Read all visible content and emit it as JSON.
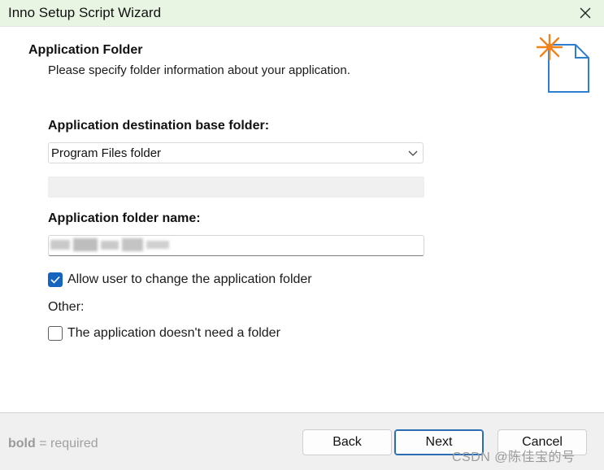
{
  "window": {
    "title": "Inno Setup Script Wizard"
  },
  "header": {
    "title": "Application Folder",
    "subtitle": "Please specify folder information about your application."
  },
  "form": {
    "base_folder_label": "Application destination base folder:",
    "base_folder_selected": "Program Files folder",
    "custom_folder_value": "",
    "folder_name_label": "Application folder name:",
    "folder_name_value": "",
    "allow_change_label": "Allow user to change the application folder",
    "allow_change_checked": true,
    "other_label": "Other:",
    "no_folder_label": "The application doesn't need a folder",
    "no_folder_checked": false
  },
  "footer": {
    "legend_bold": "bold",
    "legend_rest": " = required",
    "back_label": "Back",
    "next_label": "Next",
    "cancel_label": "Cancel",
    "watermark": "CSDN @陈佳宝的号"
  },
  "colors": {
    "titlebar_bg": "#e9f5e3",
    "checkbox_accent": "#1565c0",
    "icon_blue": "#2f7fd0",
    "icon_orange": "#f0821e",
    "footer_bg": "#f0f0f0"
  },
  "icons": {
    "close": "close-icon",
    "wizard": "wizard-document-icon",
    "dropdown": "chevron-down-icon",
    "check": "checkmark-icon"
  }
}
